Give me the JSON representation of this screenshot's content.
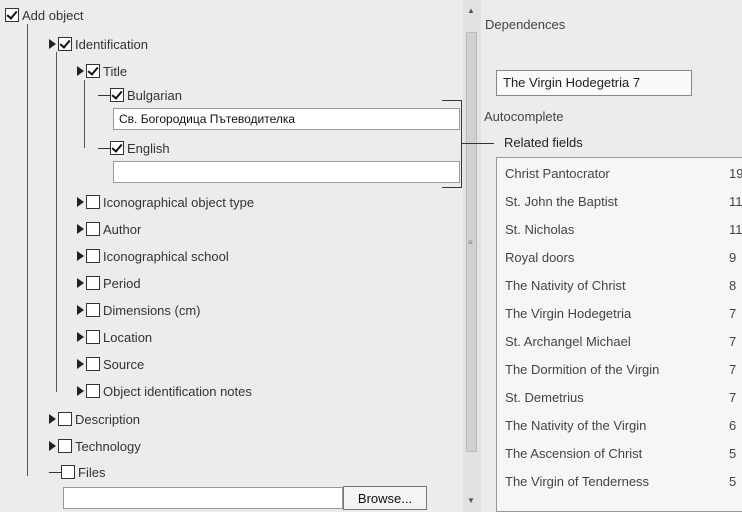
{
  "tree": {
    "root": {
      "label": "Add object",
      "checked": true
    },
    "identification": {
      "label": "Identification",
      "checked": true
    },
    "title": {
      "label": "Title",
      "checked": true
    },
    "bulgarian": {
      "label": "Bulgarian",
      "checked": true,
      "value": "Св. Богородица Пътеводителка"
    },
    "english": {
      "label": "English",
      "checked": true,
      "value": ""
    },
    "identification_children": [
      {
        "label": "Iconographical object type",
        "checked": false
      },
      {
        "label": "Author",
        "checked": false
      },
      {
        "label": "Iconographical school",
        "checked": false
      },
      {
        "label": "Period",
        "checked": false
      },
      {
        "label": "Dimensions (cm)",
        "checked": false
      },
      {
        "label": "Location",
        "checked": false
      },
      {
        "label": "Source",
        "checked": false
      },
      {
        "label": "Object identification notes",
        "checked": false
      }
    ],
    "description": {
      "label": "Description",
      "checked": false
    },
    "technology": {
      "label": "Technology",
      "checked": false
    },
    "files": {
      "label": "Files",
      "checked": false,
      "value": "",
      "browse_label": "Browse..."
    }
  },
  "right": {
    "dependences_title": "Dependences",
    "dependence_value": "The Virgin Hodegetria  7",
    "autocomplete_title": "Autocomplete",
    "related_title": "Related fields",
    "related_items": [
      {
        "name": "Christ Pantocrator",
        "count": "19"
      },
      {
        "name": "St. John the Baptist",
        "count": "11"
      },
      {
        "name": "St. Nicholas",
        "count": "11"
      },
      {
        "name": "Royal doors",
        "count": "9"
      },
      {
        "name": "The Nativity of Christ",
        "count": "8"
      },
      {
        "name": "The Virgin Hodegetria",
        "count": "7"
      },
      {
        "name": "St. Archangel Michael",
        "count": "7"
      },
      {
        "name": "The Dormition of the Virgin",
        "count": "7"
      },
      {
        "name": "St. Demetrius",
        "count": "7"
      },
      {
        "name": "The Nativity of the Virgin",
        "count": "6"
      },
      {
        "name": "The Ascension of Christ",
        "count": "5"
      },
      {
        "name": "The Virgin of Tenderness",
        "count": "5"
      }
    ]
  }
}
